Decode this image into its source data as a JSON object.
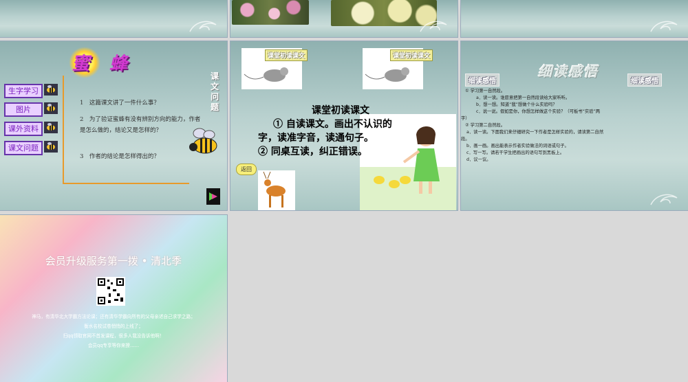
{
  "slide4": {
    "title": "蜜 蜂",
    "nav": [
      "生字学习",
      "图片",
      "课外资料",
      "课文问题"
    ],
    "questions": [
      "1　这篇课文讲了一件什么事？",
      "2　为了验证蜜蜂有没有辨别方向的能力，作者是怎么做的，结论又是怎样的？",
      "3　作者的结论是怎样得出的？"
    ],
    "vertical_title": "课文问题"
  },
  "slide5": {
    "label_left": "课堂初读课文",
    "label_right": "课堂初读课文",
    "heading": "课堂初读课文",
    "lines": [
      "① 自读课文。画出不认识的",
      "字，读准字音，读通句子。",
      "② 同桌互读，纠正错误。"
    ],
    "back": "返回"
  },
  "slide6": {
    "badge_left": "细读感悟",
    "title": "细读感悟",
    "badge_right": "细读感悟",
    "lines": [
      "① 学习第一自然段。",
      "a．读一读。谁愿意把第一自然段读给大家听听。",
      "b．想一想。知道“我”想做个什么实验吗？",
      "c．说一说。假如是你，你想怎样做这个实验？（可板书“实验”两",
      "字）",
      "② 学习第二自然段。",
      "a．读一读。下面我们来仔细研究一下作者是怎样实验的，请读第二自然",
      "段。",
      "b．画一画。画出能表示作者实验做法的词语或句子。",
      "c．写一写。请若干学生把画出的语句写到黑板上。",
      "d．议一议。"
    ]
  },
  "slide7": {
    "heading": "会员升级服务第一拨 • 清北季",
    "p1": "神马，有清华北大学霸方法论课；还有清华学霸向所有的父母亲述自己求学之路；",
    "p2": "衡水名校试卷悄悄的上线了；",
    "p3": "扫qq领取官网不首发课程，很多人我没告诉他啊！",
    "p4": "会员qq专享等你来撩……"
  },
  "colors": {
    "purple": "#7a1fbf",
    "orange": "#e89a2a",
    "yellow_label": "#f3ef9b"
  }
}
